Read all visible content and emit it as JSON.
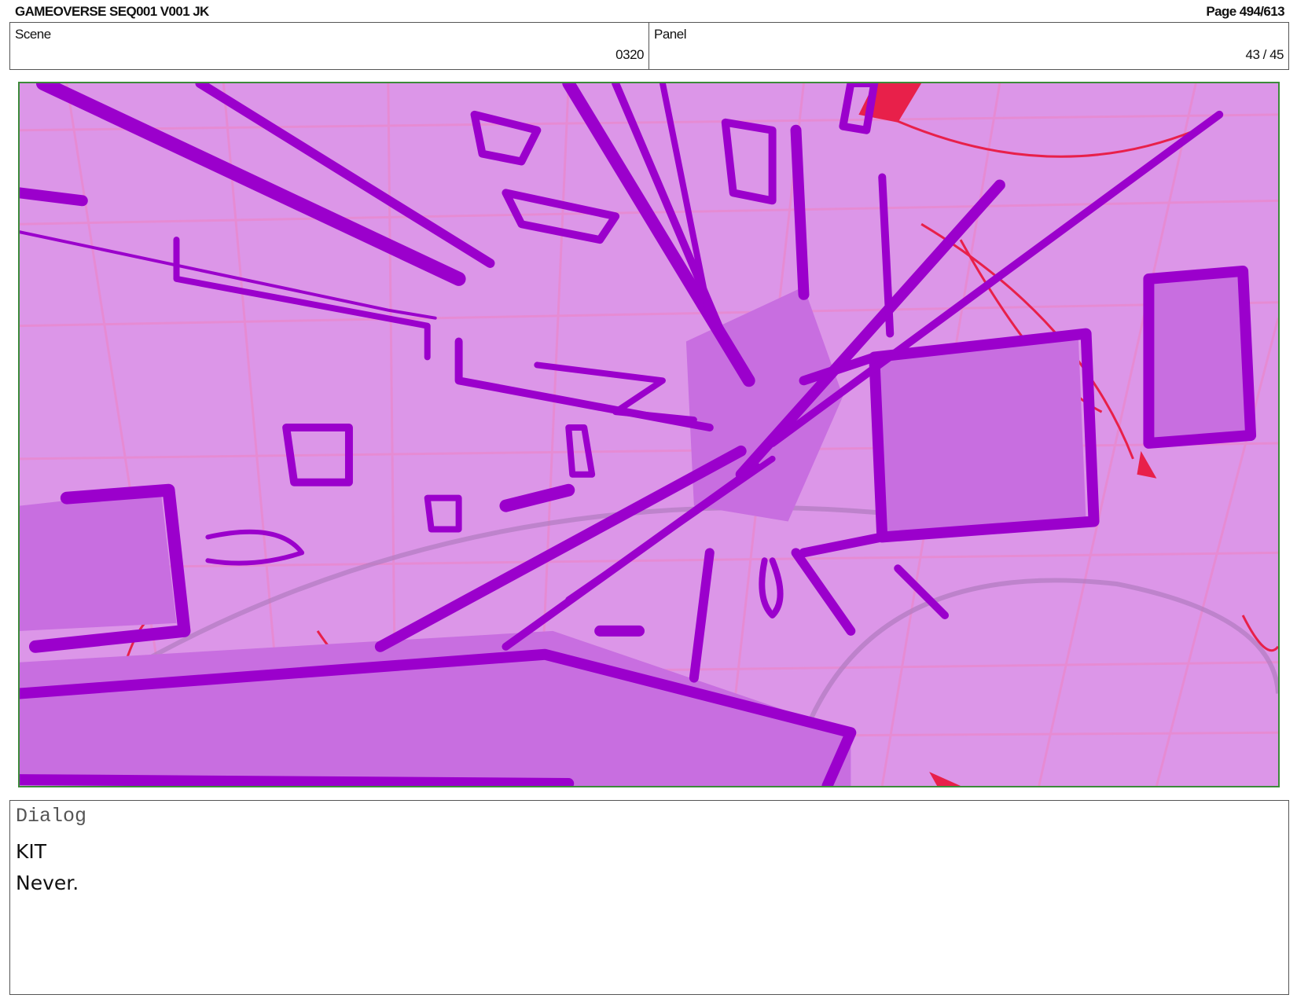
{
  "header": {
    "title": "GAMEOVERSE SEQ001 V001 JK",
    "page": "Page 494/613"
  },
  "info": {
    "scene_label": "Scene",
    "scene_value": "0320",
    "panel_label": "Panel",
    "panel_value": "43 / 45"
  },
  "panel_image": {
    "description_colors": {
      "background": "#dc96e8",
      "main_purple": "#9b00cc",
      "fill_purple": "#c86ee0",
      "grid_pink": "#e88ad0",
      "accent_red": "#e8204a",
      "frame_green": "#3c8a3a"
    }
  },
  "dialog": {
    "label": "Dialog",
    "speaker": "KIT",
    "line": "Never."
  }
}
